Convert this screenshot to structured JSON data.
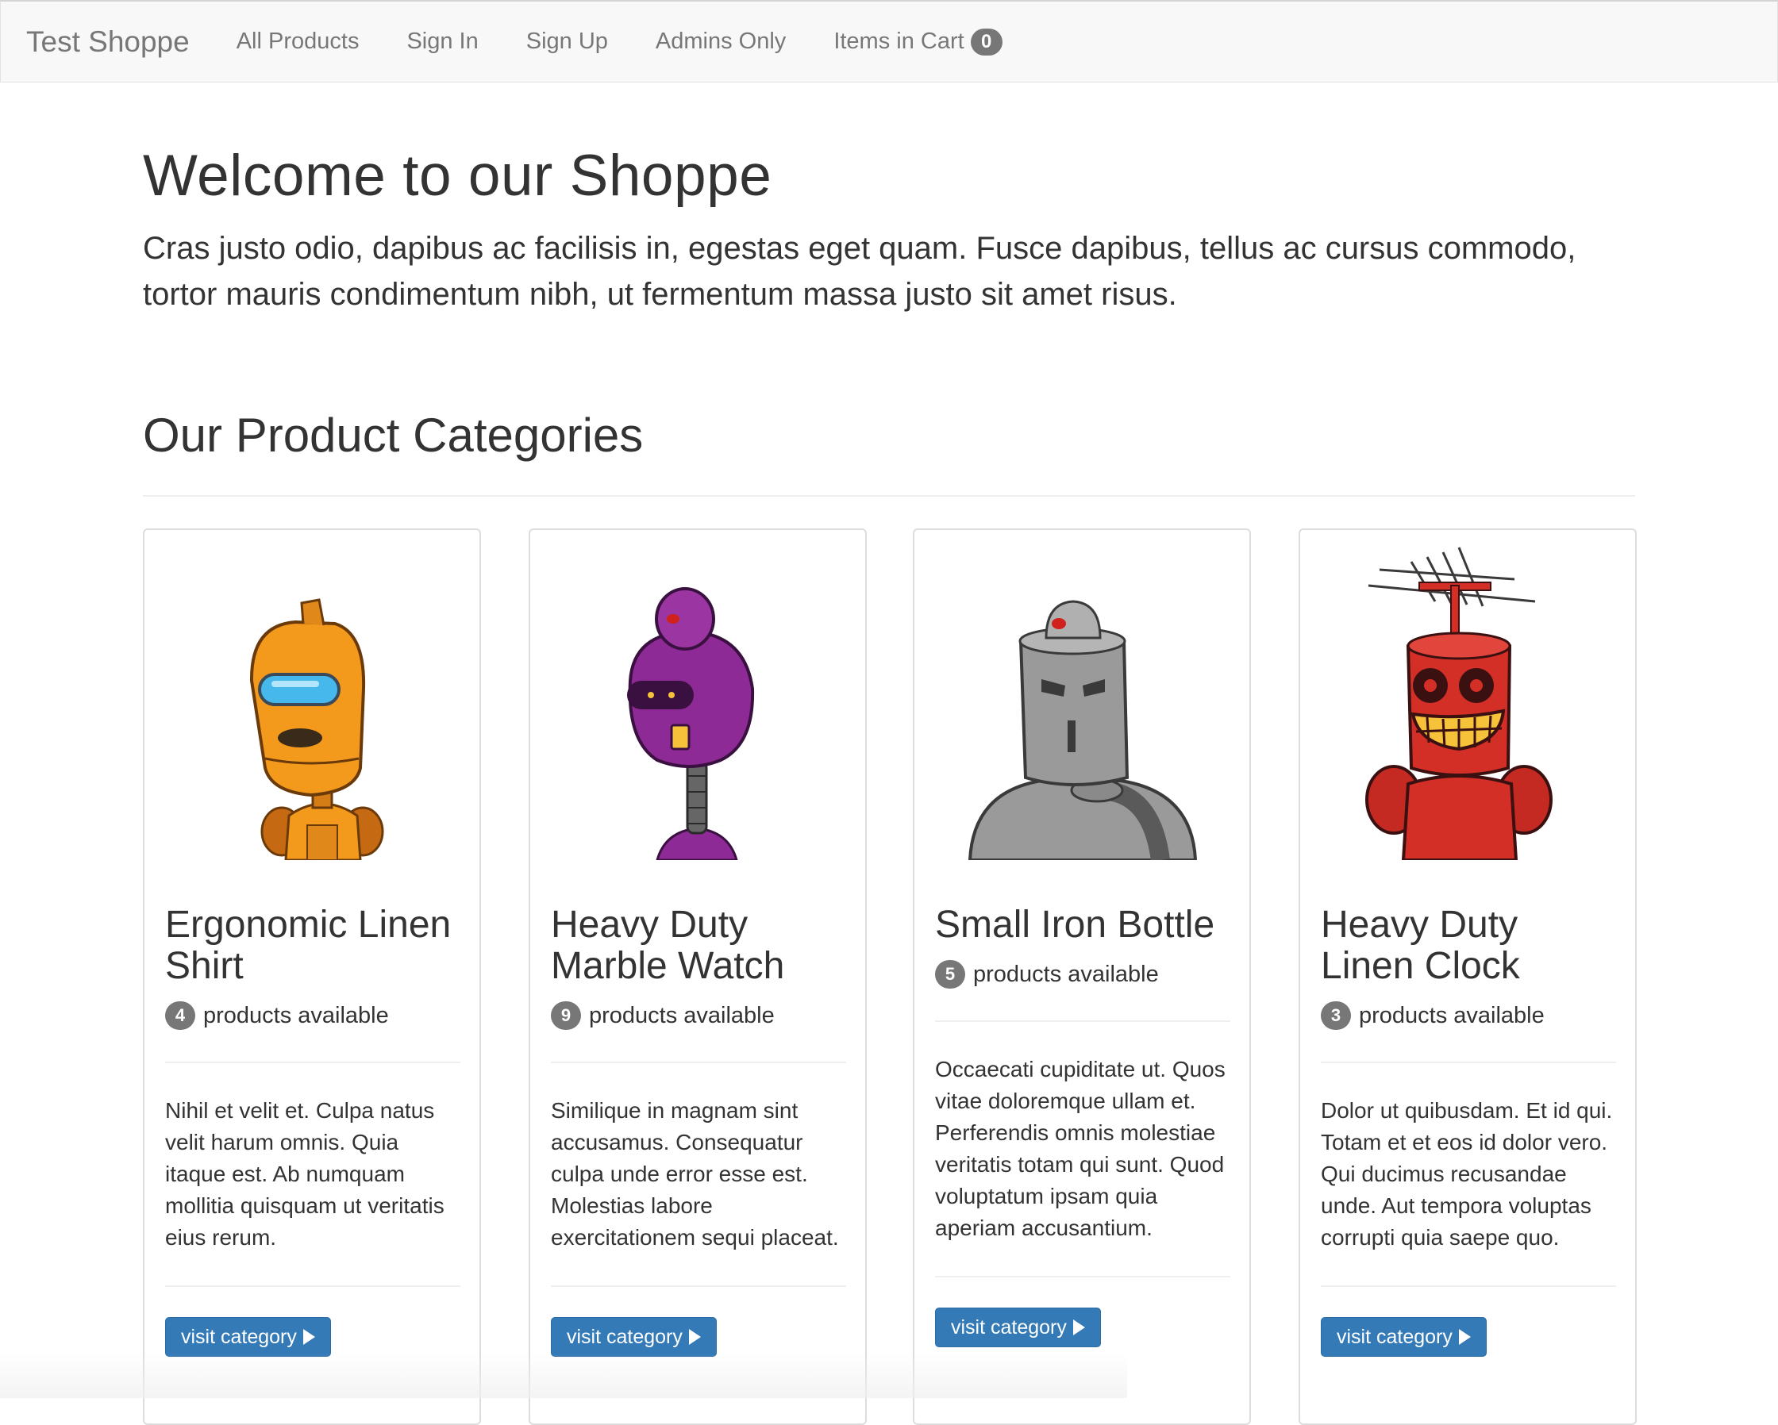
{
  "navbar": {
    "brand": "Test Shoppe",
    "links": [
      "All Products",
      "Sign In",
      "Sign Up",
      "Admins Only"
    ],
    "cart_label": "Items in Cart",
    "cart_count": "0"
  },
  "hero": {
    "title": "Welcome to our Shoppe",
    "lead": "Cras justo odio, dapibus ac facilisis in, egestas eget quam. Fusce dapibus, tellus ac cursus commodo, tortor mauris condimentum nibh, ut fermentum massa justo sit amet risus."
  },
  "categories": {
    "title": "Our Product Categories",
    "items": [
      {
        "title": "Ergonomic Linen Shirt",
        "count": "4",
        "available_label": "products available",
        "description": "Nihil et velit et. Culpa natus velit harum omnis. Quia itaque est. Ab numquam mollitia quisquam ut veritatis eius rerum.",
        "button": "visit category",
        "robot_color": "#f39a1c",
        "icon": "orange-robot-icon"
      },
      {
        "title": "Heavy Duty Marble Watch",
        "count": "9",
        "available_label": "products available",
        "description": "Similique in magnam sint accusamus. Consequatur culpa unde error esse est. Molestias labore exercitationem sequi placeat.",
        "button": "visit category",
        "robot_color": "#8e2a96",
        "icon": "purple-robot-icon"
      },
      {
        "title": "Small Iron Bottle",
        "count": "5",
        "available_label": "products available",
        "description": "Occaecati cupiditate ut. Quos vitae doloremque ullam et. Perferendis omnis molestiae veritatis totam qui sunt. Quod voluptatum ipsam quia aperiam accusantium.",
        "button": "visit category",
        "robot_color": "#9a9a9a",
        "icon": "gray-robot-icon"
      },
      {
        "title": "Heavy Duty Linen Clock",
        "count": "3",
        "available_label": "products available",
        "description": "Dolor ut quibusdam. Et id qui. Totam et et eos id dolor vero. Qui ducimus recusandae unde. Aut tempora voluptas corrupti quia saepe quo.",
        "button": "visit category",
        "robot_color": "#d32f27",
        "icon": "red-robot-icon"
      }
    ]
  },
  "colors": {
    "primary_button": "#337ab7",
    "badge": "#777777",
    "navbar_bg": "#f8f8f8"
  }
}
